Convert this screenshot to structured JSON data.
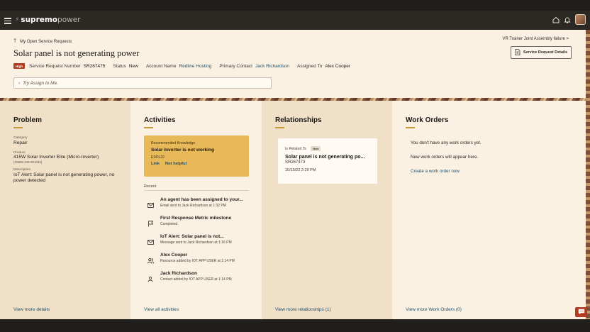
{
  "app": {
    "brand_bolt": "⚡",
    "brand_part1": "supremo",
    "brand_part2": "power"
  },
  "icons": {
    "menu": "hamburger-icon",
    "home": "home-icon",
    "notifications": "bell-icon",
    "profile": "avatar",
    "assign_caret": "chevron-right-icon",
    "details": "document-icon",
    "back": "arrow-up-icon",
    "chat": "chat-icon"
  },
  "header": {
    "back_arrow": "🡑",
    "back_label": "My Open Service Requests",
    "next_label": "VR Trainer Joint Assembly failure >",
    "title": "Solar panel is not generating power",
    "details_button": "Service Request Details",
    "priority_badge": "High",
    "meta": {
      "sr_label": "Service Request Number",
      "sr_value": "SR267475",
      "status_label": "Status",
      "status_value": "New",
      "account_label": "Account Name",
      "account_value": "Redline Hosting",
      "contact_label": "Primary Contact",
      "contact_value": "Jack Richardson",
      "assigned_label": "Assigned To",
      "assigned_value": "Alex Cooper"
    },
    "assign_caret": "›",
    "assign_placeholder": "Try Assign to Me."
  },
  "problem": {
    "heading": "Problem",
    "category_label": "Category",
    "category_value": "Repair",
    "product_label": "Product",
    "product_value": "415W Solar Inverter Elite (Micro-Inverter)",
    "product_code": "(#SBW-415-001033)",
    "description_label": "Description",
    "description_value": "IoT Alert: Solar panel is not generating power, no power detected",
    "footer_link": "View more details"
  },
  "activities": {
    "heading": "Activities",
    "knowledge": {
      "label": "Recommended Knowledge",
      "title": "Solar Inverter is not working",
      "code": "ESOL22",
      "link_label": "Link",
      "not_helpful_label": "Not helpful"
    },
    "recent_label": "Recent",
    "items": [
      {
        "icon": "mail-icon",
        "title": "An agent has been assigned to your...",
        "subtitle": "Email sent to Jack Richardson at 1:32 PM"
      },
      {
        "icon": "flag-icon",
        "title": "First Response Metric milestone",
        "subtitle": "Completed"
      },
      {
        "icon": "mail-icon",
        "title": "IoT Alert: Solar panel is not...",
        "subtitle": "Message sent to Jack Richardson at 1:16 PM"
      },
      {
        "icon": "people-icon",
        "title": "Alex Cooper",
        "subtitle": "Resource added by IOT APP USER at 1:14 PM"
      },
      {
        "icon": "person-icon",
        "title": "Jack Richardson",
        "subtitle": "Contact added by IOT APP USER at 1:14 PM"
      }
    ],
    "footer_link": "View all activities"
  },
  "relationships": {
    "heading": "Relationships",
    "card": {
      "relation_label": "Is Related To",
      "badge": "New",
      "title": "Solar panel is not generating po...",
      "number": "SR267473",
      "datetime": "10/15/22 2:29 PM"
    },
    "footer_link": "View more relationships (1)"
  },
  "work_orders": {
    "heading": "Work Orders",
    "empty_line1": "You don't have any work orders yet.",
    "empty_line2": "New work orders will appear here.",
    "create_link": "Create a work order now",
    "footer_link": "View more Work Orders (0)"
  },
  "colors": {
    "accent_gold": "#c79a3c",
    "knowledge_card": "#e8b959",
    "high_badge": "#b33a1f",
    "link_blue": "#1e4f6b",
    "panel_tan": "#f0e0c8",
    "panel_cream": "#fbf1e2"
  }
}
